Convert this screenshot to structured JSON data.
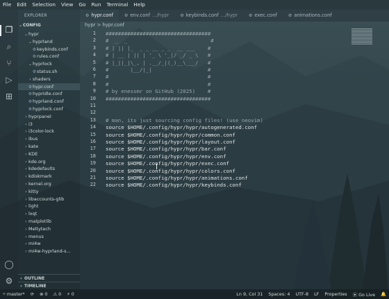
{
  "menu": [
    "File",
    "Edit",
    "Selection",
    "View",
    "Go",
    "Run",
    "Terminal",
    "Help"
  ],
  "sidebar": {
    "title": "EXPLORER",
    "root": "CONFIG",
    "items": [
      {
        "label": "hypr",
        "kind": "folder-open",
        "depth": 1
      },
      {
        "label": "hyprland",
        "kind": "folder-open",
        "depth": 2
      },
      {
        "label": "keybinds.conf",
        "kind": "file",
        "depth": 3
      },
      {
        "label": "rules.conf",
        "kind": "file",
        "depth": 3
      },
      {
        "label": "hyprlock",
        "kind": "folder-open",
        "depth": 2
      },
      {
        "label": "status.sh",
        "kind": "file",
        "depth": 3
      },
      {
        "label": "shaders",
        "kind": "folder",
        "depth": 2
      },
      {
        "label": "hypr.conf",
        "kind": "file",
        "depth": 2,
        "selected": true
      },
      {
        "label": "hypridle.conf",
        "kind": "file",
        "depth": 2
      },
      {
        "label": "hyprland.conf",
        "kind": "file",
        "depth": 2
      },
      {
        "label": "hyprlock.conf",
        "kind": "file",
        "depth": 2
      },
      {
        "label": "hyprpanel",
        "kind": "folder",
        "depth": 1
      },
      {
        "label": "i3",
        "kind": "folder",
        "depth": 1
      },
      {
        "label": "i3color-lock",
        "kind": "folder",
        "depth": 1
      },
      {
        "label": "ibus",
        "kind": "folder",
        "depth": 1
      },
      {
        "label": "kate",
        "kind": "folder",
        "depth": 1
      },
      {
        "label": "KDE",
        "kind": "folder",
        "depth": 1
      },
      {
        "label": "kde.org",
        "kind": "folder",
        "depth": 1
      },
      {
        "label": "kdedefaults",
        "kind": "folder",
        "depth": 1
      },
      {
        "label": "kdiskmark",
        "kind": "folder",
        "depth": 1
      },
      {
        "label": "kernel.org",
        "kind": "folder",
        "depth": 1
      },
      {
        "label": "kitty",
        "kind": "folder",
        "depth": 1
      },
      {
        "label": "libaccounts-glib",
        "kind": "folder",
        "depth": 1
      },
      {
        "label": "light",
        "kind": "folder",
        "depth": 1
      },
      {
        "label": "lxqt",
        "kind": "folder",
        "depth": 1
      },
      {
        "label": "matplotlib",
        "kind": "folder",
        "depth": 1
      },
      {
        "label": "Meltytech",
        "kind": "folder",
        "depth": 1
      },
      {
        "label": "menus",
        "kind": "folder",
        "depth": 1
      },
      {
        "label": "mi4w",
        "kind": "folder",
        "depth": 1
      },
      {
        "label": "mi4w-hyprland-s...",
        "kind": "folder",
        "depth": 1
      }
    ],
    "outline": "OUTLINE",
    "timeline": "TIMELINE"
  },
  "tabs": [
    {
      "label": "hypr.conf",
      "active": true
    },
    {
      "label": "env.conf",
      "hint": ".../hypr"
    },
    {
      "label": "keybinds.conf",
      "hint": ".../hypr"
    },
    {
      "label": "exec.conf"
    },
    {
      "label": "animations.conf"
    }
  ],
  "breadcrumb": "hypr > hypr.conf",
  "editor": {
    "lines": [
      {
        "n": "1",
        "text": "##################################",
        "comment": true
      },
      {
        "n": "2",
        "text": "#  _  _                           #",
        "comment": true
      },
      {
        "n": "3",
        "text": "# | || |_  _ _ __ _ _  __ ___    #",
        "comment": true
      },
      {
        "n": "4",
        "text": "# | __ | || | '_ \\ '_|/ _/ _ \\   #",
        "comment": true
      },
      {
        "n": "5",
        "text": "# |_||_|\\_, | .__/_|(_)__\\___/   #",
        "comment": true
      },
      {
        "n": "6",
        "text": "#       |__/|_|                  #",
        "comment": true
      },
      {
        "n": "7",
        "text": "#                                #",
        "comment": true
      },
      {
        "n": "8",
        "text": "#                                #",
        "comment": true
      },
      {
        "n": "9",
        "text": "# by enessmr on GitHub (2025)    #",
        "comment": true
      },
      {
        "n": "10",
        "text": "##################################",
        "comment": true
      },
      {
        "n": "11",
        "text": ""
      },
      {
        "n": "12",
        "text": ""
      },
      {
        "n": "13",
        "text": "# man, its just sourcing config files! (use neovim)",
        "comment": true
      },
      {
        "n": "14",
        "text": "source $HOME/.config/hypr/hypr/autogenerated.conf"
      },
      {
        "n": "15",
        "text": "source $HOME/.config/hypr/hypr/common.conf"
      },
      {
        "n": "16",
        "text": "source $HOME/.config/hypr/hypr/layout.conf"
      },
      {
        "n": "17",
        "text": "source $HOME/.config/hypr/hypr/bar.conf"
      },
      {
        "n": "18",
        "text": "source $HOME/.config/hypr/hypr/env.conf"
      },
      {
        "n": "19",
        "text": "source $HOME/.config/hypr/hypr/exec.conf"
      },
      {
        "n": "20",
        "text": "source $HOME/.config/hypr/hypr/colors.conf"
      },
      {
        "n": "21",
        "text": "source $HOME/.config/hypr/hypr/animations.conf"
      },
      {
        "n": "22",
        "text": "source $HOME/.config/hypr/hypr/keybinds.conf"
      }
    ]
  },
  "status": {
    "branch": "master*",
    "sync": "⟳",
    "errors": "⊗ 0",
    "warnings": "⚠ 0",
    "ports": "⚡ 0",
    "position": "Ln 9, Col 31",
    "spaces": "Spaces: 4",
    "encoding": "UTF-8",
    "eol": "LF",
    "language": "Properties",
    "golive": "Go Live"
  }
}
